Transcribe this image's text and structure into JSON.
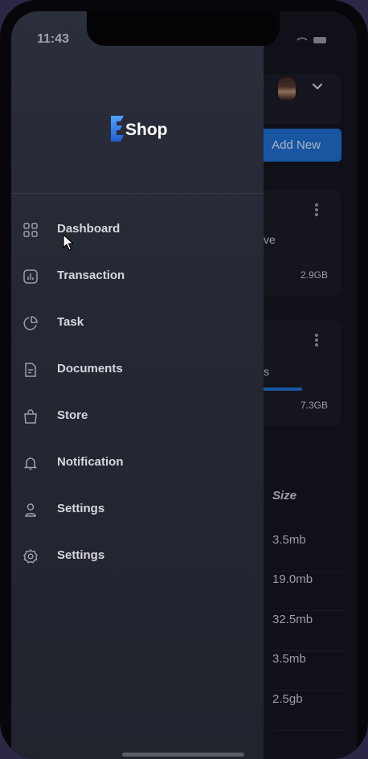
{
  "status_bar": {
    "time": "11:43"
  },
  "background_app": {
    "add_new_label": "Add New",
    "cards": [
      {
        "label_fragment": "ve",
        "size": "2.9GB"
      },
      {
        "label_fragment": "s",
        "size": "7.3GB"
      }
    ],
    "size_column_header": "Size",
    "sizes": [
      "3.5mb",
      "19.0mb",
      "32.5mb",
      "3.5mb",
      "2.5gb"
    ]
  },
  "drawer": {
    "logo_text": "Shop",
    "menu": [
      {
        "label": "Dashboard",
        "icon": "grid-icon"
      },
      {
        "label": "Transaction",
        "icon": "chart-icon"
      },
      {
        "label": "Task",
        "icon": "pie-icon"
      },
      {
        "label": "Documents",
        "icon": "document-icon"
      },
      {
        "label": "Store",
        "icon": "bag-icon"
      },
      {
        "label": "Notification",
        "icon": "bell-icon"
      },
      {
        "label": "Settings",
        "icon": "user-icon"
      },
      {
        "label": "Settings",
        "icon": "gear-icon"
      }
    ]
  },
  "colors": {
    "accent": "#1f6fd0",
    "drawer_bg": "#262a35",
    "text": "#d6d7dd"
  }
}
